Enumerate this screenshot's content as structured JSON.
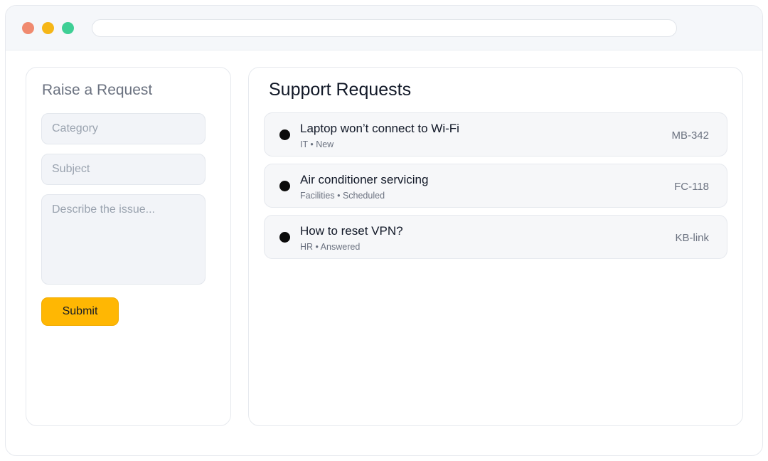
{
  "form": {
    "title": "Raise a Request",
    "category_placeholder": "Category",
    "subject_placeholder": "Subject",
    "describe_placeholder": "Describe the issue...",
    "submit_label": "Submit"
  },
  "requests": {
    "title": "Support Requests",
    "items": [
      {
        "title": "Laptop won’t connect to Wi-Fi",
        "meta": "IT • New",
        "id": "MB-342"
      },
      {
        "title": "Air conditioner servicing",
        "meta": "Facilities • Scheduled",
        "id": "FC-118"
      },
      {
        "title": "How to reset VPN?",
        "meta": "HR • Answered",
        "id": "KB-link"
      }
    ]
  },
  "colors": {
    "accent": "#ffb703",
    "window_close": "#f08a6f",
    "window_minimize": "#f5b617",
    "window_maximize": "#3ecf95"
  }
}
